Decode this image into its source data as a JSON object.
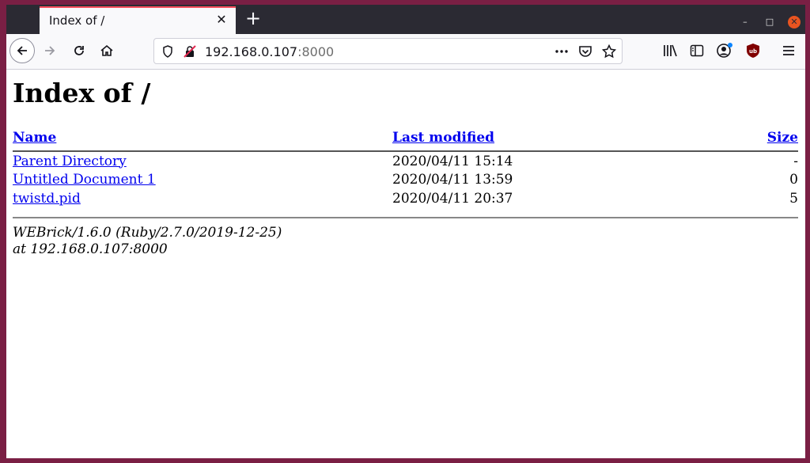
{
  "browser": {
    "tab_title": "Index of /",
    "tab_close": "✕",
    "new_tab": "+",
    "url_host": "192.168.0.107",
    "url_port": ":8000",
    "window_controls": {
      "minimize": "–",
      "maximize": "□",
      "close": "✕"
    }
  },
  "page": {
    "title": "Index of /",
    "headers": {
      "name": "Name",
      "modified": "Last modified",
      "size": "Size"
    },
    "rows": [
      {
        "name": "Parent Directory",
        "modified": "2020/04/11 15:14",
        "size": "-"
      },
      {
        "name": "Untitled Document 1",
        "modified": "2020/04/11 13:59",
        "size": "0"
      },
      {
        "name": "twistd.pid",
        "modified": "2020/04/11 20:37",
        "size": "5"
      }
    ],
    "footer_line1": "WEBrick/1.6.0 (Ruby/2.7.0/2019-12-25)",
    "footer_line2": "at 192.168.0.107:8000"
  },
  "colors": {
    "link": "#0000ee",
    "tab_accent": "#ff4f5e",
    "desktop_bg": "#7a1f44"
  }
}
